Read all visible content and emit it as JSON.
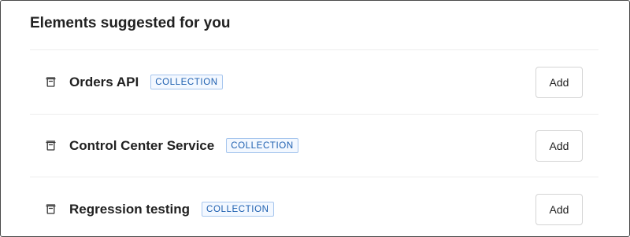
{
  "panel": {
    "title": "Elements suggested for you"
  },
  "items": [
    {
      "name": "Orders API",
      "badge": "COLLECTION",
      "icon": "collection-icon",
      "action_label": "Add"
    },
    {
      "name": "Control Center Service",
      "badge": "COLLECTION",
      "icon": "collection-icon",
      "action_label": "Add"
    },
    {
      "name": "Regression testing",
      "badge": "COLLECTION",
      "icon": "collection-icon",
      "action_label": "Add"
    }
  ],
  "colors": {
    "badge_text": "#1d5fb0",
    "badge_border": "#a7c6ee",
    "badge_bg": "#f3f8ff",
    "divider": "#ededed",
    "text": "#212121"
  }
}
